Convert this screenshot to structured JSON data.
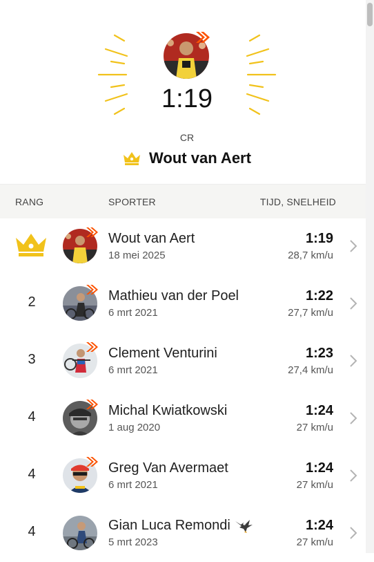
{
  "hero": {
    "time": "1:19",
    "record_label": "CR",
    "holder_name": "Wout van Aert",
    "accent_color": "#f1c21b",
    "badge_color": "#fc5200"
  },
  "table": {
    "headers": {
      "rank": "RANG",
      "athlete": "SPORTER",
      "time_speed": "TIJD, SNELHEID"
    },
    "rows": [
      {
        "rank": "",
        "rank_icon": "crown-icon",
        "name": "Wout van Aert",
        "date": "18 mei 2025",
        "time": "1:19",
        "speed": "28,7 km/u",
        "avatar_bg": "#b02a20"
      },
      {
        "rank": "2",
        "name": "Mathieu van der Poel",
        "date": "6 mrt 2021",
        "time": "1:22",
        "speed": "27,7 km/u",
        "avatar_bg": "#6d7482"
      },
      {
        "rank": "3",
        "name": "Clement Venturini",
        "date": "6 mrt 2021",
        "time": "1:23",
        "speed": "27,4 km/u",
        "avatar_bg": "#d7dde3"
      },
      {
        "rank": "4",
        "name": "Michal Kwiatkowski",
        "date": "1 aug 2020",
        "time": "1:24",
        "speed": "27 km/u",
        "avatar_bg": "#4a4a4a"
      },
      {
        "rank": "4",
        "name": "Greg Van Avermaet",
        "date": "6 mrt 2021",
        "time": "1:24",
        "speed": "27 km/u",
        "avatar_bg": "#2e3b52"
      },
      {
        "rank": "4",
        "name": "Gian Luca Remondi",
        "date": "5 mrt 2023",
        "time": "1:24",
        "speed": "27 km/u",
        "avatar_bg": "#7d8793",
        "extra_icon": "eagle-icon"
      }
    ]
  }
}
